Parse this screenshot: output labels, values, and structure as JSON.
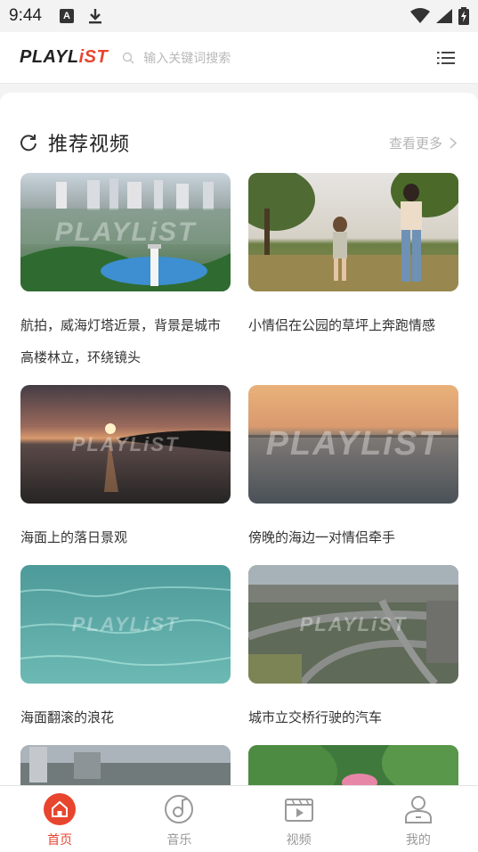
{
  "status_bar": {
    "time": "9:44",
    "badge_letter": "A"
  },
  "header": {
    "logo_main": "PLAYL",
    "logo_accent": "iST",
    "search_placeholder": "输入关键词搜索"
  },
  "section": {
    "title": "推荐视频",
    "more_label": "查看更多"
  },
  "watermark": "PLAYLiST",
  "videos": [
    {
      "title": "航拍，威海灯塔近景，背景是城市高楼林立，环绕镜头"
    },
    {
      "title": "小情侣在公园的草坪上奔跑情感"
    },
    {
      "title": "海面上的落日景观"
    },
    {
      "title": "傍晚的海边一对情侣牵手"
    },
    {
      "title": "海面翻滚的浪花"
    },
    {
      "title": "城市立交桥行驶的汽车"
    }
  ],
  "nav": {
    "items": [
      {
        "label": "首页",
        "icon": "home-icon",
        "active": true
      },
      {
        "label": "音乐",
        "icon": "music-disc-icon",
        "active": false
      },
      {
        "label": "视频",
        "icon": "video-icon",
        "active": false
      },
      {
        "label": "我的",
        "icon": "user-icon",
        "active": false
      }
    ]
  },
  "colors": {
    "accent": "#e8452f",
    "muted": "#999999"
  }
}
